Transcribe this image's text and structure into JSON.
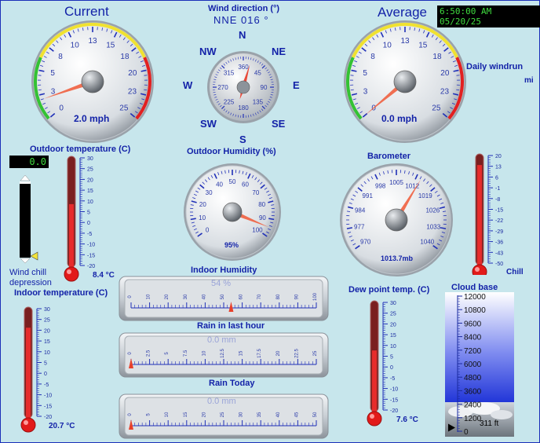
{
  "header": {
    "current_label": "Current",
    "average_label": "Average",
    "timestamp": "6:50:00 AM 05/20/25"
  },
  "wind_direction": {
    "title": "Wind direction (°)",
    "reading": "NNE  016 °",
    "compass": {
      "n": "N",
      "ne": "NE",
      "e": "E",
      "se": "SE",
      "s": "S",
      "sw": "SW",
      "w": "W",
      "nw": "NW"
    },
    "dial_ticks": [
      "360",
      "45",
      "90",
      "135",
      "180",
      "225",
      "270",
      "315"
    ],
    "needle_deg": 16
  },
  "current_wind": {
    "value_text": "2.0 mph",
    "value": 2.0,
    "ticks": [
      "0",
      "3",
      "5",
      "8",
      "10",
      "13",
      "15",
      "18",
      "20",
      "23",
      "25"
    ]
  },
  "average_wind": {
    "value_text": "0.0 mph",
    "value": 0.0,
    "ticks": [
      "0",
      "3",
      "5",
      "8",
      "10",
      "13",
      "15",
      "18",
      "20",
      "23",
      "25"
    ]
  },
  "daily_windrun": {
    "label": "Daily windrun",
    "unit": "mi"
  },
  "outdoor_temp": {
    "title": "Outdoor temperature (C)",
    "value_text": "8.4 °C",
    "value": 8.4,
    "scale": [
      "30",
      "25",
      "20",
      "15",
      "10",
      "5",
      "0",
      "-5",
      "-10",
      "-15",
      "-20"
    ]
  },
  "wind_chill": {
    "value_text": "0.0",
    "label_line1": "Wind chill",
    "label_line2": "depression"
  },
  "outdoor_humidity": {
    "title": "Outdoor Humidity (%)",
    "value_text": "95%",
    "value": 95,
    "ticks": [
      "0",
      "10",
      "20",
      "30",
      "40",
      "50",
      "60",
      "70",
      "80",
      "90",
      "100"
    ]
  },
  "barometer": {
    "title": "Barometer",
    "value_text": "1013.7mb",
    "value": 1013.7,
    "ticks": [
      "970",
      "977",
      "984",
      "991",
      "998",
      "1005",
      "1012",
      "1019",
      "1026",
      "1033",
      "1040"
    ]
  },
  "chill": {
    "label": "Chill",
    "scale": [
      "20",
      "13",
      "6",
      "-1",
      "-8",
      "-15",
      "-22",
      "-29",
      "-36",
      "-43",
      "-50"
    ],
    "value": 13
  },
  "indoor_humidity": {
    "title": "Indoor Humidity",
    "value_text": "54 %",
    "value": 54,
    "scale": [
      "0",
      "10",
      "20",
      "30",
      "40",
      "50",
      "60",
      "70",
      "80",
      "90",
      "100"
    ]
  },
  "rain_hour": {
    "title": "Rain in last hour",
    "value_text": "0.0 mm",
    "value": 0,
    "scale": [
      "0",
      "2.5",
      "5",
      "7.5",
      "10",
      "12.5",
      "15",
      "17.5",
      "20",
      "22.5",
      "25"
    ]
  },
  "rain_today": {
    "title": "Rain Today",
    "value_text": "0.0 mm",
    "value": 0,
    "scale": [
      "0",
      "5",
      "10",
      "15",
      "20",
      "25",
      "30",
      "35",
      "40",
      "45",
      "50"
    ]
  },
  "indoor_temp": {
    "title": "Indoor temperature (C)",
    "value_text": "20.7 °C",
    "value": 20.7,
    "scale": [
      "30",
      "25",
      "20",
      "15",
      "10",
      "5",
      "0",
      "-5",
      "-10",
      "-15",
      "-20"
    ]
  },
  "dew_point": {
    "title": "Dew point temp. (C)",
    "value_text": "7.6 °C",
    "value": 7.6,
    "scale": [
      "30",
      "25",
      "20",
      "15",
      "10",
      "5",
      "0",
      "-5",
      "-10",
      "-15",
      "-20"
    ]
  },
  "cloud_base": {
    "title": "Cloud base",
    "value_text": "311 ft",
    "value": 311,
    "scale": [
      "12000",
      "10800",
      "9600",
      "8400",
      "7200",
      "6000",
      "4800",
      "3600",
      "2400",
      "1200",
      "0"
    ]
  }
}
